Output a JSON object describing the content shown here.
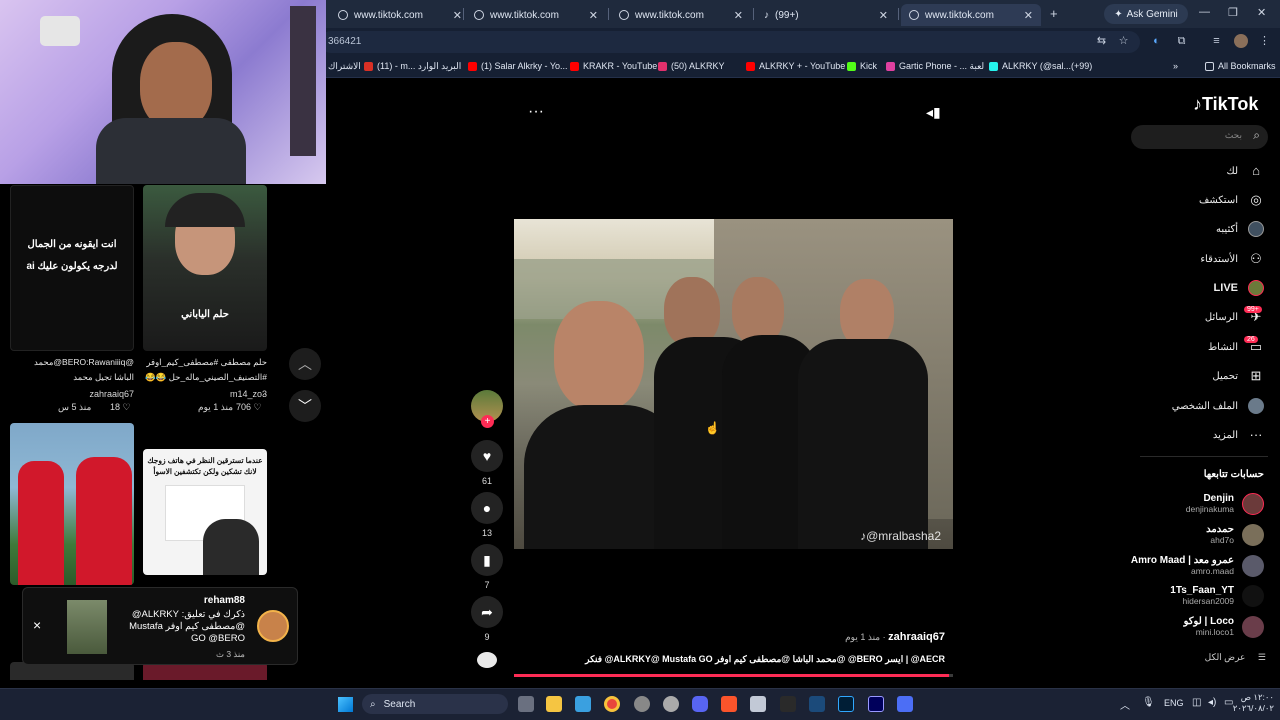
{
  "browser": {
    "tabs": [
      {
        "title": "www.tiktok.com"
      },
      {
        "title": "www.tiktok.com"
      },
      {
        "title": "www.tiktok.com"
      },
      {
        "title": "(99+)"
      },
      {
        "title": "www.tiktok.com"
      }
    ],
    "new_tab": "+",
    "gemini_label": "Ask Gemini",
    "url": "366421",
    "bookmarks": [
      {
        "label": "الاشتراك",
        "color": "#7f8b9f"
      },
      {
        "label": "(11) - m... البريد الوارد",
        "color": "#d93025"
      },
      {
        "label": "(1) Salar Alkrky - Yo...",
        "color": "#ff0000"
      },
      {
        "label": "KRAKR - YouTube",
        "color": "#ff0000"
      },
      {
        "label": "(50) ALKRKY",
        "color": "#e1306c"
      },
      {
        "label": "ALKRKY + - YouTube",
        "color": "#ff0000"
      },
      {
        "label": "Kick",
        "color": "#53fc18"
      },
      {
        "label": "Gartic Phone - ... لعبة",
        "color": "#e040a0"
      },
      {
        "label": "ALKRKY (@sal...(+99)",
        "color": "#25f4ee"
      }
    ],
    "all_bookmarks": "All Bookmarks",
    "more_bookmarks": "»"
  },
  "feed": {
    "items": [
      {
        "overlay": "انت ايقونه من الجمال لدرجه يكولون عليك ai",
        "caption": "@BERO:Rawaniiiq@محمد الباشا تجيل محمد",
        "author": "zahraaiq67",
        "likes": "18",
        "age": "منذ 5 س"
      },
      {
        "overlay": "حلم الياباني",
        "caption": "حلم مصطفى #مصطفى_كيم_اوفر #التصنيف_الصيني_ماله_حل 😂😂 ...",
        "author": "m14_zo3",
        "likes": "706",
        "age": "منذ 1 يوم"
      },
      {
        "overlay": "",
        "caption": "",
        "author": "",
        "likes": "",
        "age": ""
      },
      {
        "overlay": "عندما تسترقين النظر في هاتف زوجك لانك تشكين ولكن تكتشفين الاسوأ",
        "caption": "",
        "author": "",
        "likes": "",
        "age": ""
      }
    ],
    "nav_up": "︿",
    "nav_down": "﹀"
  },
  "notification": {
    "user": "reham88",
    "text": "ذكرك في تعليق: ALKRKY@ @مصطفى كيم اوفر Mustafa GO @BERO",
    "time": "منذ 3 ث",
    "close": "×"
  },
  "video": {
    "more": "···",
    "watermark": "@mralbasha2",
    "author": "zahraaiq67",
    "age": "منذ 1 يوم",
    "caption": "AECR@ | ايسر BERO@ @محمد الباشا @مصطفى كيم اوفر ALKRKY@ Mustafa GO@ فنكر",
    "progress": 0.99
  },
  "actions": [
    {
      "name": "like",
      "count": "61"
    },
    {
      "name": "comment",
      "count": "13"
    },
    {
      "name": "save",
      "count": "7"
    },
    {
      "name": "share",
      "count": "9"
    }
  ],
  "sidebar": {
    "logo": "TikTok",
    "search_placeholder": "بحث",
    "nav": [
      {
        "label": "لك",
        "icon": "home-icon"
      },
      {
        "label": "استكشف",
        "icon": "compass-icon"
      },
      {
        "label": "أكثيبه",
        "icon": "avatar-icon"
      },
      {
        "label": "الأستدقاء",
        "icon": "friends-icon"
      },
      {
        "label": "LIVE",
        "icon": "live-icon"
      },
      {
        "label": "الرسائل",
        "icon": "messages-icon",
        "badge": "99+"
      },
      {
        "label": "النشاط",
        "icon": "activity-icon",
        "badge": "26"
      },
      {
        "label": "تحميل",
        "icon": "upload-icon"
      },
      {
        "label": "الملف الشخصي",
        "icon": "profile-icon"
      },
      {
        "label": "المزيد",
        "icon": "more-icon"
      }
    ],
    "following_title": "حسابات تتابعها",
    "accounts": [
      {
        "name": "Denjin",
        "handle": "denjinakuma",
        "color": "#6b3a3a"
      },
      {
        "name": "حمدمد",
        "handle": "ahd7o",
        "color": "#7a6f5a"
      },
      {
        "name": "Amro Maad | عمرو معد",
        "handle": "amro.maad",
        "color": "#5a5a6a"
      },
      {
        "name": "1Ts_Faan_YT",
        "handle": "hidersan2009",
        "color": "#222222"
      },
      {
        "name": "لوكو | Loco",
        "handle": "mini.loco1",
        "color": "#6a3d4a"
      }
    ],
    "see_all": "عرض الكل"
  },
  "taskbar": {
    "search": "Search",
    "lang": "ENG",
    "time": "١٢:٠٠ ص",
    "date": "٢٠٢٦/٠٨/٠٢"
  }
}
